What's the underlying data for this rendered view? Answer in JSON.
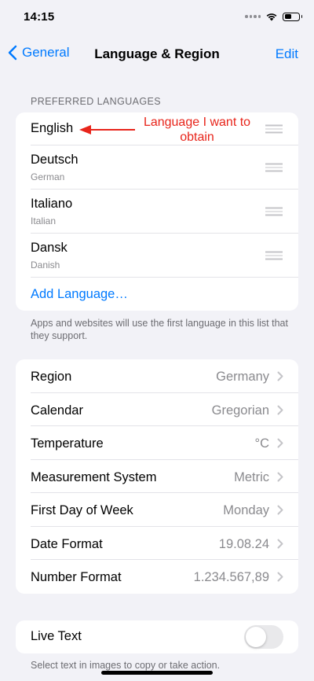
{
  "status": {
    "time": "14:15"
  },
  "nav": {
    "back_label": "General",
    "title": "Language & Region",
    "edit_label": "Edit"
  },
  "languages_header": "PREFERRED LANGUAGES",
  "languages": [
    {
      "name": "English",
      "subtitle": ""
    },
    {
      "name": "Deutsch",
      "subtitle": "German"
    },
    {
      "name": "Italiano",
      "subtitle": "Italian"
    },
    {
      "name": "Dansk",
      "subtitle": "Danish"
    }
  ],
  "add_language_label": "Add Language…",
  "languages_footer": "Apps and websites will use the first language in this list that they support.",
  "settings": [
    {
      "label": "Region",
      "value": "Germany"
    },
    {
      "label": "Calendar",
      "value": "Gregorian"
    },
    {
      "label": "Temperature",
      "value": "°C"
    },
    {
      "label": "Measurement System",
      "value": "Metric"
    },
    {
      "label": "First Day of Week",
      "value": "Monday"
    },
    {
      "label": "Date Format",
      "value": "19.08.24"
    },
    {
      "label": "Number Format",
      "value": "1.234.567,89"
    }
  ],
  "live_text": {
    "label": "Live Text",
    "enabled": false
  },
  "live_text_footer": "Select text in images to copy or take action.",
  "annotation": {
    "text": "Language I want to obtain",
    "color": "#E8251B"
  },
  "colors": {
    "accent": "#007AFF",
    "background": "#F2F2F7",
    "secondary_text": "#8A8A8E"
  }
}
